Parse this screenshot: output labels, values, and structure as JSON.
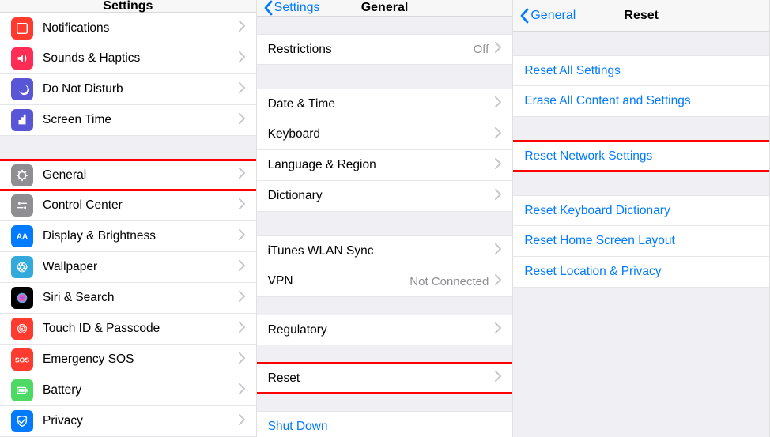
{
  "panel1": {
    "title": "Settings",
    "group1": [
      {
        "label": "Notifications",
        "icon": "notifications",
        "bg": "#ff3b30"
      },
      {
        "label": "Sounds & Haptics",
        "icon": "sounds",
        "bg": "#ff2d55"
      },
      {
        "label": "Do Not Disturb",
        "icon": "dnd",
        "bg": "#5856d6"
      },
      {
        "label": "Screen Time",
        "icon": "screentime",
        "bg": "#5856d6"
      }
    ],
    "group2": [
      {
        "label": "General",
        "icon": "general",
        "bg": "#8e8e93",
        "highlight": true
      },
      {
        "label": "Control Center",
        "icon": "control",
        "bg": "#8e8e93"
      },
      {
        "label": "Display & Brightness",
        "icon": "display",
        "bg": "#007aff"
      },
      {
        "label": "Wallpaper",
        "icon": "wallpaper",
        "bg": "#34aadc"
      },
      {
        "label": "Siri & Search",
        "icon": "siri",
        "bg": "#000"
      },
      {
        "label": "Touch ID & Passcode",
        "icon": "touchid",
        "bg": "#ff3b30"
      },
      {
        "label": "Emergency SOS",
        "icon": "sos",
        "bg": "#ff3b30"
      },
      {
        "label": "Battery",
        "icon": "battery",
        "bg": "#4cd964"
      },
      {
        "label": "Privacy",
        "icon": "privacy",
        "bg": "#007aff"
      }
    ]
  },
  "panel2": {
    "back": "Settings",
    "title": "General",
    "g1": [
      {
        "label": "Restrictions",
        "value": "Off"
      }
    ],
    "g2": [
      {
        "label": "Date & Time"
      },
      {
        "label": "Keyboard"
      },
      {
        "label": "Language & Region"
      },
      {
        "label": "Dictionary"
      }
    ],
    "g3": [
      {
        "label": "iTunes WLAN Sync"
      },
      {
        "label": "VPN",
        "value": "Not Connected"
      }
    ],
    "g4": [
      {
        "label": "Regulatory"
      }
    ],
    "g5": [
      {
        "label": "Reset",
        "highlight": true
      }
    ],
    "g6": [
      {
        "label": "Shut Down",
        "blue": true,
        "nochev": true
      }
    ]
  },
  "panel3": {
    "back": "General",
    "title": "Reset",
    "g1": [
      {
        "label": "Reset All Settings"
      },
      {
        "label": "Erase All Content and Settings"
      }
    ],
    "g2": [
      {
        "label": "Reset Network Settings",
        "highlight": true
      }
    ],
    "g3": [
      {
        "label": "Reset Keyboard Dictionary"
      },
      {
        "label": "Reset Home Screen Layout"
      },
      {
        "label": "Reset Location & Privacy"
      }
    ]
  }
}
